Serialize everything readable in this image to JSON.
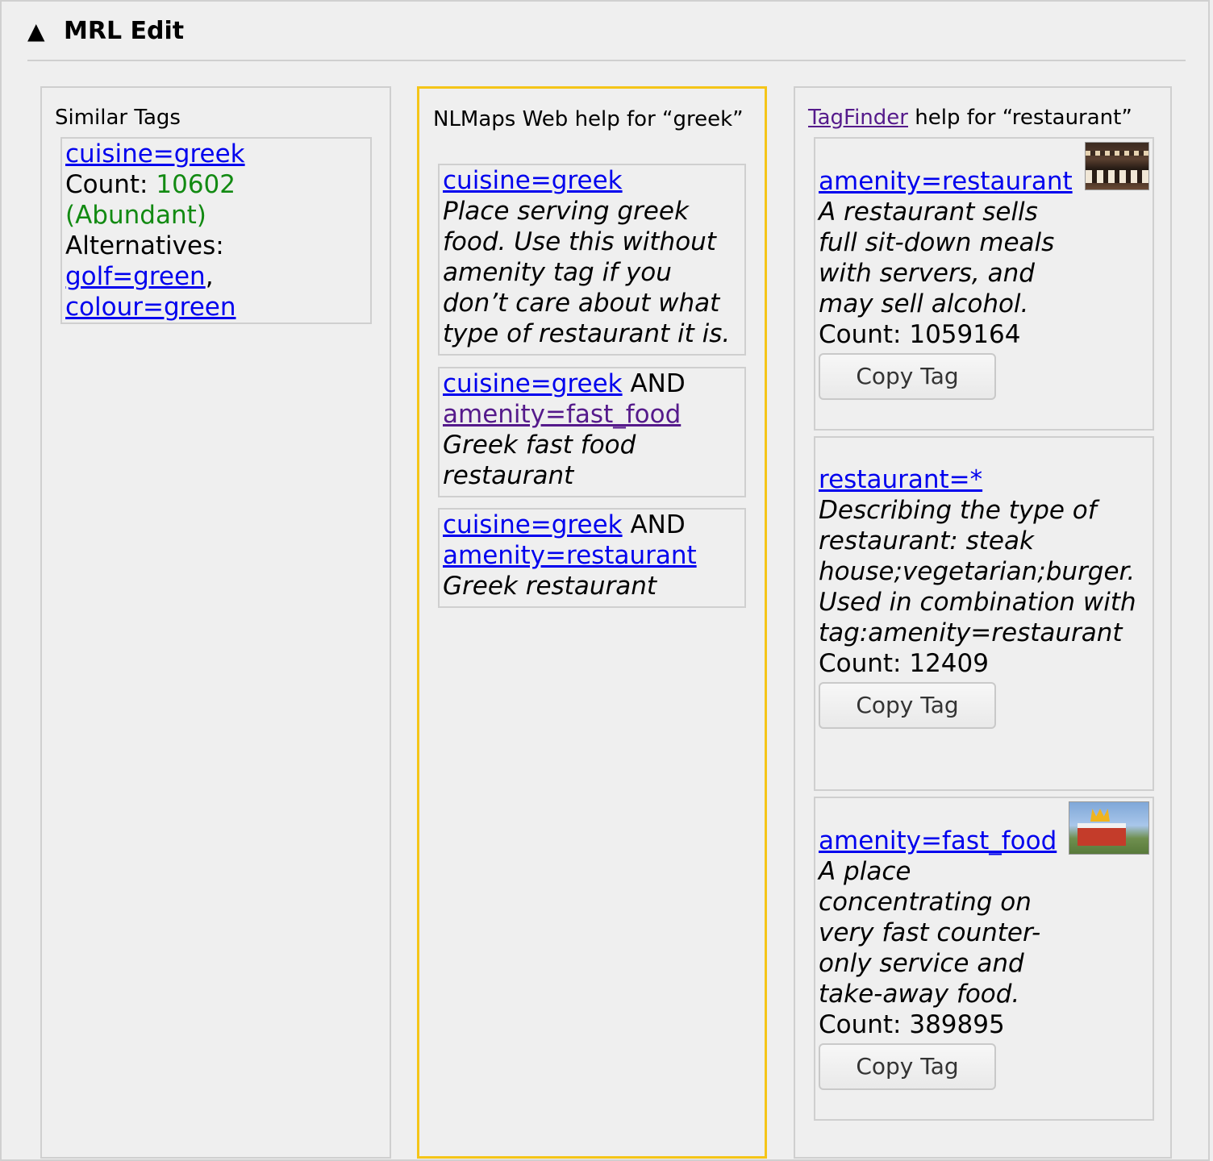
{
  "header": {
    "title": "MRL Edit",
    "toggle_icon": "▲"
  },
  "similar_tags": {
    "title": "Similar Tags",
    "tag": "cuisine=greek",
    "count_label": "Count:",
    "count_value": "10602",
    "count_status": "(Abundant)",
    "alternatives_label": "Alternatives:",
    "alternatives": [
      "golf=green",
      "colour=green"
    ],
    "separator": ","
  },
  "nlmaps_help": {
    "title": "NLMaps Web help for “greek”",
    "items": [
      {
        "tag": "cuisine=greek",
        "desc": "Place serving greek food. Use this without amenity tag if you don’t care about what type of restaurant it is."
      },
      {
        "tag": "cuisine=greek",
        "and": "AND",
        "tag2": "amenity=fast_food",
        "desc": "Greek fast food restaurant"
      },
      {
        "tag": "cuisine=greek",
        "and": "AND",
        "tag2": "amenity=restaurant",
        "desc": "Greek restaurant"
      }
    ]
  },
  "tagfinder": {
    "link": "TagFinder",
    "title_rest": " help for “restaurant”",
    "button_label": "Copy Tag",
    "items": [
      {
        "tag": "amenity=restaurant",
        "desc": "A restaurant sells full sit-down meals with servers, and may sell alcohol.",
        "count": "Count: 1059164"
      },
      {
        "tag": "restaurant=*",
        "desc": "Describing the type of restaurant: steak house;vegetarian;burger. Used in combination with tag:amenity=restaurant",
        "count": "Count: 12409"
      },
      {
        "tag": "amenity=fast_food",
        "desc": "A place concentrating on very fast counter-only service and take-away food.",
        "count": "Count: 389895"
      }
    ]
  },
  "colors": {
    "link": "#0000ee",
    "visited": "#551a8b",
    "abundant": "#128a12",
    "highlight": "#f5c518"
  }
}
